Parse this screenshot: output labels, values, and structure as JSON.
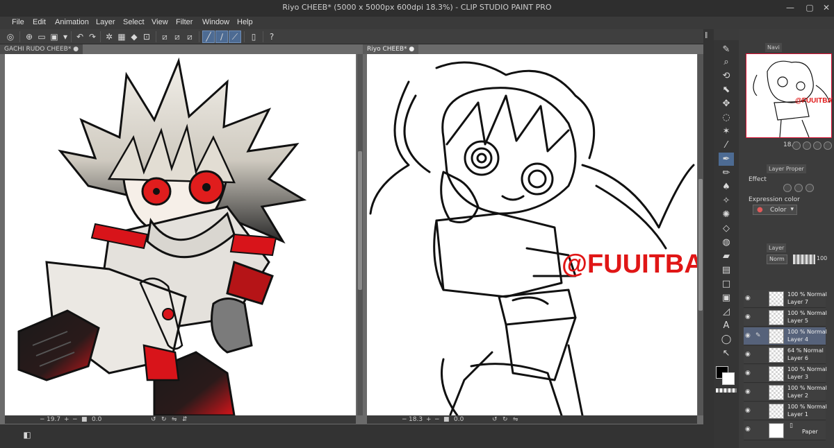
{
  "window": {
    "title": "Riyo CHEEB* (5000 x 5000px 600dpi 18.3%) - CLIP STUDIO PAINT PRO"
  },
  "menu": [
    "File",
    "Edit",
    "Animation",
    "Layer",
    "Select",
    "View",
    "Filter",
    "Window",
    "Help"
  ],
  "canvases": [
    {
      "tab": "GACHI RUDO CHEEB*",
      "zoom": "19.7",
      "angle": "0.0"
    },
    {
      "tab": "Riyo CHEEB*",
      "zoom": "18.3",
      "angle": "0.0",
      "watermark": "@FUUITBAT"
    }
  ],
  "navigator": {
    "tab": "Navi",
    "zoom": "18.3",
    "watermark": "@FUUITBAT"
  },
  "layer_property": {
    "tab": "Layer Proper",
    "effect_label": "Effect",
    "expression_label": "Expression color",
    "expression_value": "Color"
  },
  "layer_panel": {
    "tab": "Layer",
    "blend_mode": "Norm",
    "opacity": "100",
    "layers": [
      {
        "mode": "100 % Normal",
        "name": "Layer 7",
        "visible": true,
        "active": false
      },
      {
        "mode": "100 % Normal",
        "name": "Layer 5",
        "visible": true,
        "active": false
      },
      {
        "mode": "100 % Normal",
        "name": "Layer 4",
        "visible": true,
        "active": true
      },
      {
        "mode": "64 % Normal",
        "name": "Layer 6",
        "visible": true,
        "active": false
      },
      {
        "mode": "100 % Normal",
        "name": "Layer 3",
        "visible": true,
        "active": false
      },
      {
        "mode": "100 % Normal",
        "name": "Layer 2",
        "visible": true,
        "active": false
      },
      {
        "mode": "100 % Normal",
        "name": "Layer 1",
        "visible": true,
        "active": false
      }
    ],
    "paper": "Paper"
  },
  "colors": {
    "accent": "#4d6b93",
    "watermark": "#e01616",
    "eye_red": "#e01d1d"
  }
}
